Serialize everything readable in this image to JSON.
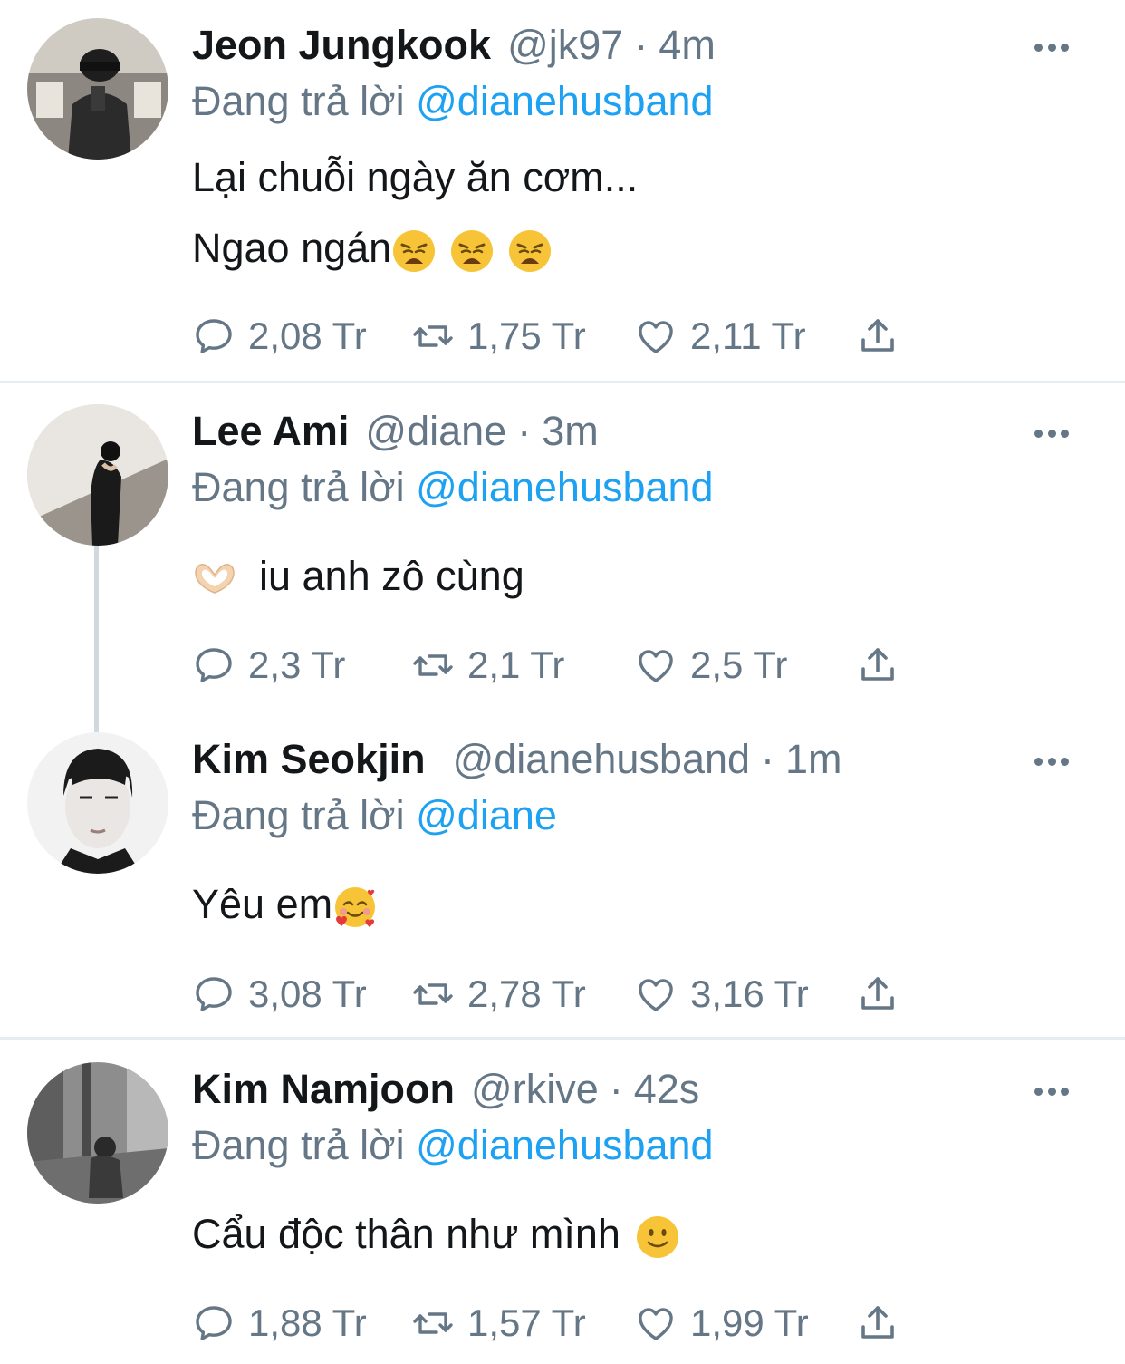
{
  "colors": {
    "accent": "#1da1f2",
    "secondary_text": "#657786",
    "divider": "#e6ecf0"
  },
  "tweets": [
    {
      "name": "Jeon Jungkook",
      "handle": "@jk97",
      "time": "4m",
      "reply_label": "Đang trả lời",
      "reply_to": "@dianehusband",
      "lines": [
        "Lại chuỗi ngày ăn cơm...",
        "Ngao ngán"
      ],
      "emoji": [
        "weary-face-emoji",
        "weary-face-emoji",
        "weary-face-emoji"
      ],
      "replies": "2,08 Tr",
      "retweets": "1,75 Tr",
      "likes": "2,11 Tr"
    },
    {
      "name": "Lee Ami",
      "handle": "@diane",
      "time": "3m",
      "reply_label": "Đang trả lời",
      "reply_to": "@dianehusband",
      "lines": [
        "iu anh zô cùng"
      ],
      "emoji": [
        "heart-hands-emoji"
      ],
      "replies": "2,3 Tr",
      "retweets": "2,1 Tr",
      "likes": "2,5 Tr"
    },
    {
      "name": "Kim Seokjin",
      "handle": "@dianehusband",
      "time": "1m",
      "reply_label": "Đang trả lời",
      "reply_to": "@diane",
      "lines": [
        "Yêu em"
      ],
      "emoji": [
        "smiling-face-with-hearts-emoji"
      ],
      "replies": "3,08 Tr",
      "retweets": "2,78 Tr",
      "likes": "3,16 Tr"
    },
    {
      "name": "Kim Namjoon",
      "handle": "@rkive",
      "time": "42s",
      "reply_label": "Đang trả lời",
      "reply_to": "@dianehusband",
      "lines": [
        "Cẩu độc thân như mình"
      ],
      "emoji": [
        "slightly-smiling-face-emoji"
      ],
      "replies": "1,88 Tr",
      "retweets": "1,57 Tr",
      "likes": "1,99 Tr"
    }
  ],
  "separator": "·"
}
